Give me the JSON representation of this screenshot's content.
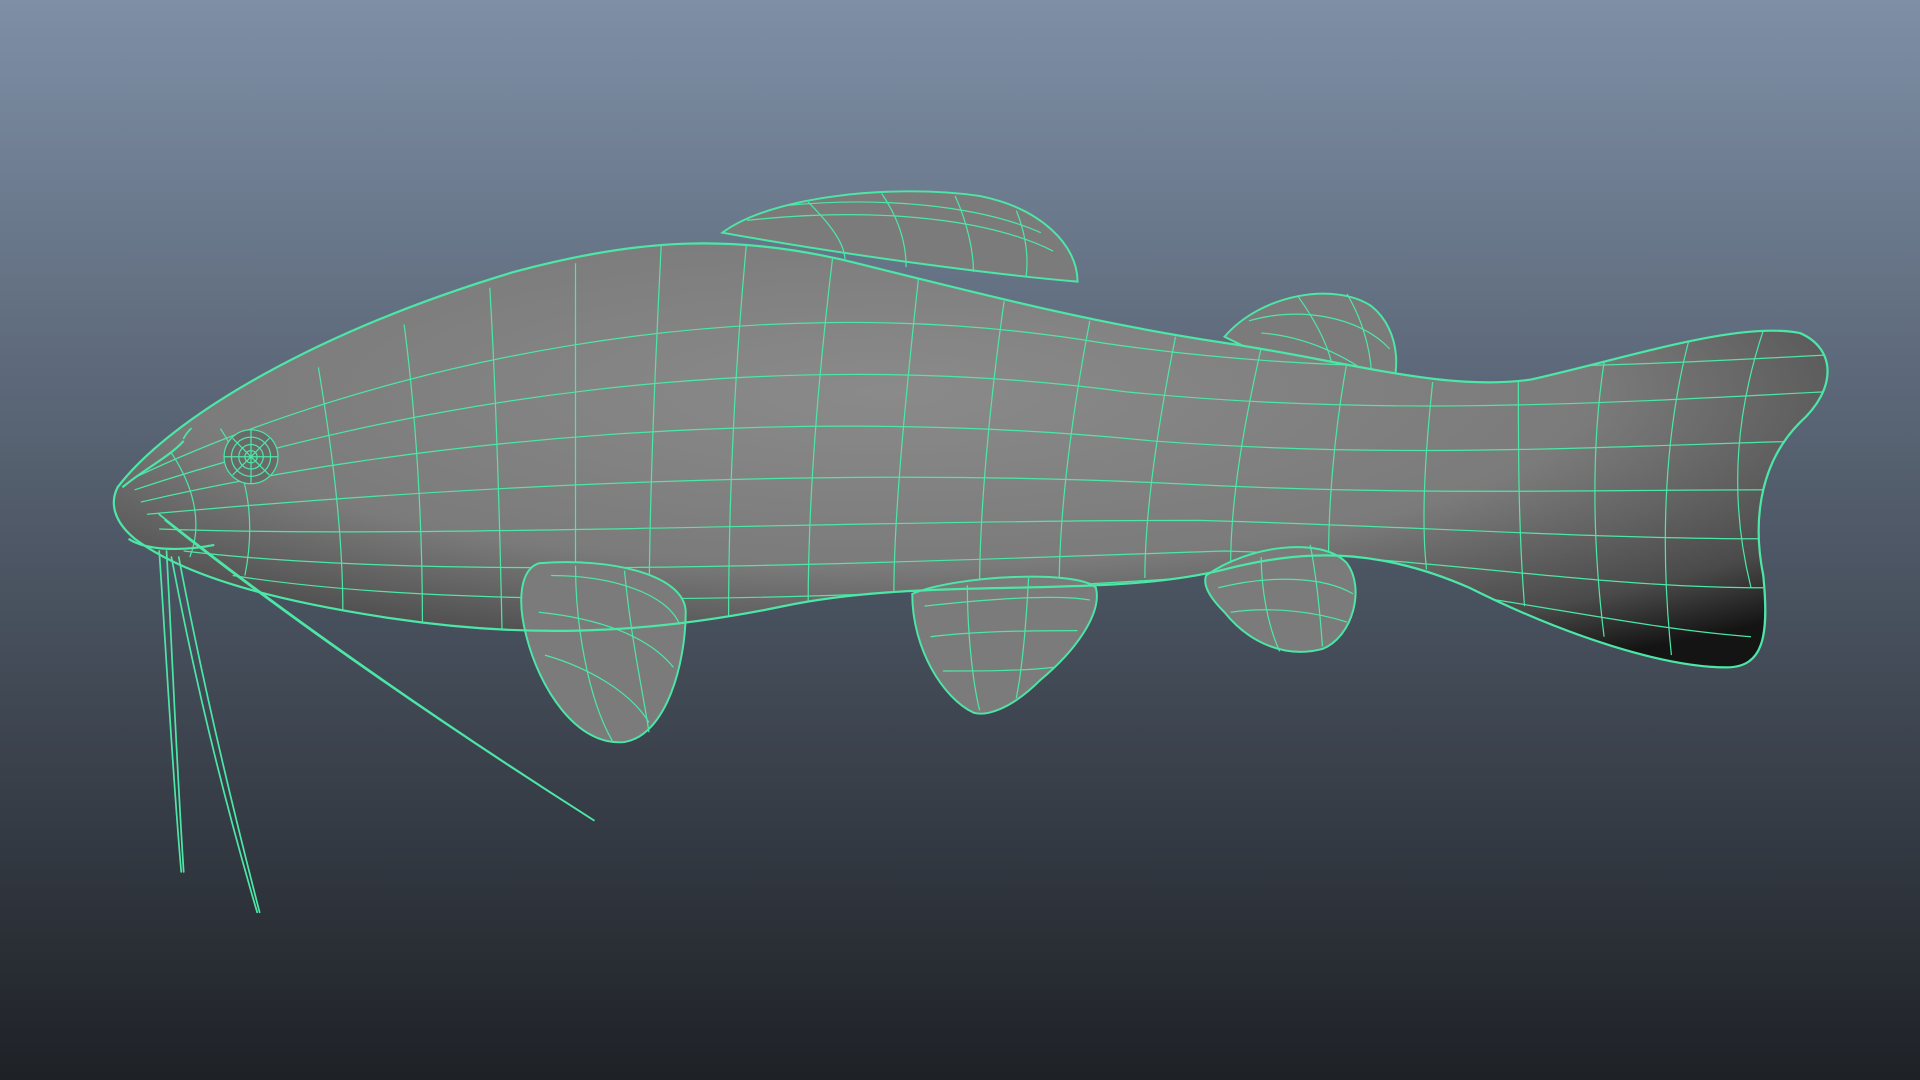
{
  "viewport": {
    "shading_mode": "wireframe-on-shaded",
    "gradient_top_color": "#7E8FA6",
    "gradient_bottom_color": "#1E2126"
  },
  "model": {
    "object_icon": "catfish-mesh-icon",
    "wire_color": "#4CE7A6",
    "shaded_color": "#7B7B7B",
    "shadow_color": "#121212",
    "selected": true
  }
}
